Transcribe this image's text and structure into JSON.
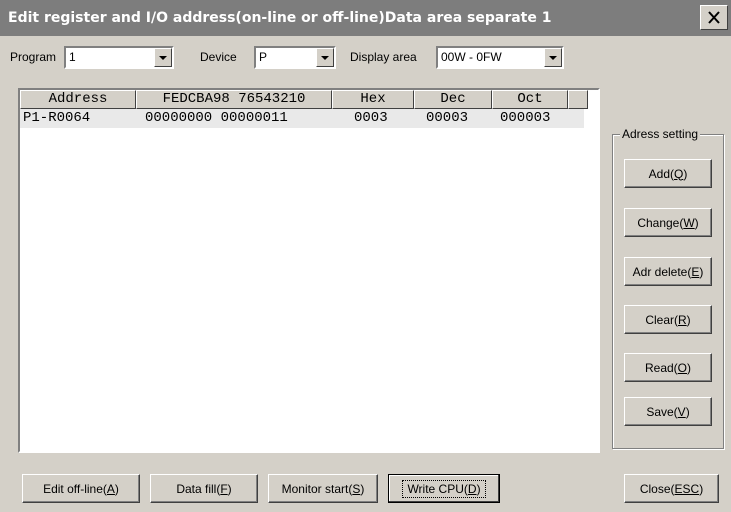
{
  "window": {
    "title": "Edit register and I/O address(on-line or off-line)Data area separate 1"
  },
  "toolbar": {
    "program_label": "Program",
    "program_value": "1",
    "device_label": "Device",
    "device_value": "P",
    "display_area_label": "Display area",
    "display_area_value": "00W - 0FW"
  },
  "table": {
    "columns": [
      "Address",
      "FEDCBA98 76543210",
      "Hex",
      "Dec",
      "Oct"
    ],
    "rows": [
      {
        "address": "P1-R0064",
        "binary": "00000000 00000011",
        "hex": "0003",
        "dec": "00003",
        "oct": "000003"
      }
    ]
  },
  "adress_setting": {
    "label": "Adress setting",
    "buttons": [
      {
        "pre": "Add(",
        "key": "Q",
        "post": ")"
      },
      {
        "pre": "Change(",
        "key": "W",
        "post": ")"
      },
      {
        "pre": "Adr delete(",
        "key": "E",
        "post": ")"
      },
      {
        "pre": "Clear(",
        "key": "R",
        "post": ")"
      },
      {
        "pre": "Read(",
        "key": "O",
        "post": ")"
      },
      {
        "pre": "Save(",
        "key": "V",
        "post": ")"
      }
    ]
  },
  "bottom_buttons": [
    {
      "pre": "Edit off-line(",
      "key": "A",
      "post": ")"
    },
    {
      "pre": "Data fill(",
      "key": "F",
      "post": ")"
    },
    {
      "pre": "Monitor start(",
      "key": "S",
      "post": ")"
    },
    {
      "pre": "Write CPU(",
      "key": "D",
      "post": ")"
    },
    {
      "pre": "Close(",
      "key": "ESC",
      "post": ")"
    }
  ]
}
